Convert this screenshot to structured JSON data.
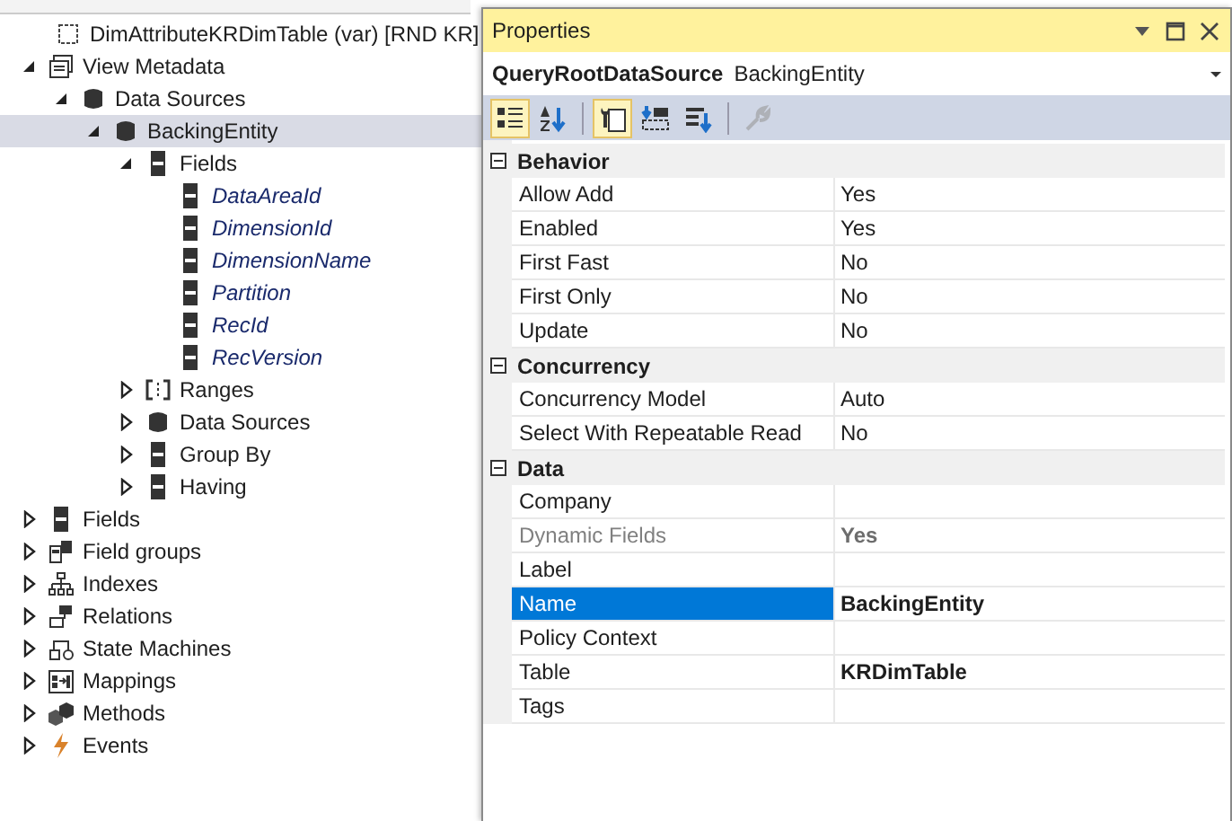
{
  "tree": {
    "label": "DimAttributeKRDimTable (var) [RND KR]",
    "kind": "root",
    "selected": false,
    "italic": false,
    "children": [
      {
        "label": "View Metadata",
        "kind": "view",
        "selected": false,
        "italic": false,
        "expanded": true,
        "children": [
          {
            "label": "Data Sources",
            "kind": "datasource",
            "selected": false,
            "italic": false,
            "expanded": true,
            "children": [
              {
                "label": "BackingEntity",
                "kind": "datasource",
                "selected": true,
                "italic": false,
                "expanded": true,
                "children": [
                  {
                    "label": "Fields",
                    "kind": "field",
                    "selected": false,
                    "italic": false,
                    "expanded": true,
                    "children": [
                      {
                        "label": "DataAreaId",
                        "kind": "field",
                        "selected": false,
                        "italic": true
                      },
                      {
                        "label": "DimensionId",
                        "kind": "field",
                        "selected": false,
                        "italic": true
                      },
                      {
                        "label": "DimensionName",
                        "kind": "field",
                        "selected": false,
                        "italic": true
                      },
                      {
                        "label": "Partition",
                        "kind": "field",
                        "selected": false,
                        "italic": true
                      },
                      {
                        "label": "RecId",
                        "kind": "field",
                        "selected": false,
                        "italic": true
                      },
                      {
                        "label": "RecVersion",
                        "kind": "field",
                        "selected": false,
                        "italic": true
                      }
                    ]
                  },
                  {
                    "label": "Ranges",
                    "kind": "ranges",
                    "selected": false,
                    "italic": false,
                    "expanded": false
                  },
                  {
                    "label": "Data Sources",
                    "kind": "datasource",
                    "selected": false,
                    "italic": false,
                    "expanded": false
                  },
                  {
                    "label": "Group By",
                    "kind": "field",
                    "selected": false,
                    "italic": false,
                    "expanded": false
                  },
                  {
                    "label": "Having",
                    "kind": "field",
                    "selected": false,
                    "italic": false,
                    "expanded": false
                  }
                ]
              }
            ]
          }
        ]
      },
      {
        "label": "Fields",
        "kind": "field",
        "selected": false,
        "italic": false,
        "expanded": false
      },
      {
        "label": "Field groups",
        "kind": "fieldgroups",
        "selected": false,
        "italic": false,
        "expanded": false
      },
      {
        "label": "Indexes",
        "kind": "indexes",
        "selected": false,
        "italic": false,
        "expanded": false
      },
      {
        "label": "Relations",
        "kind": "relations",
        "selected": false,
        "italic": false,
        "expanded": false
      },
      {
        "label": "State Machines",
        "kind": "statemachines",
        "selected": false,
        "italic": false,
        "expanded": false
      },
      {
        "label": "Mappings",
        "kind": "mappings",
        "selected": false,
        "italic": false,
        "expanded": false
      },
      {
        "label": "Methods",
        "kind": "methods",
        "selected": false,
        "italic": false,
        "expanded": false
      },
      {
        "label": "Events",
        "kind": "events",
        "selected": false,
        "italic": false,
        "expanded": false
      }
    ]
  },
  "properties": {
    "title": "Properties",
    "object_type": "QueryRootDataSource",
    "object_name": "BackingEntity",
    "toolbar": [
      {
        "kind": "categorized",
        "selected": true,
        "disabled": false
      },
      {
        "kind": "alphabetical",
        "selected": false,
        "disabled": false
      },
      {
        "kind": "properties",
        "selected": true,
        "disabled": false
      },
      {
        "kind": "events",
        "selected": false,
        "disabled": false
      },
      {
        "kind": "sort",
        "selected": false,
        "disabled": false
      },
      {
        "kind": "wrench",
        "selected": false,
        "disabled": true
      }
    ],
    "categories": [
      {
        "name": "Behavior",
        "expanded": true,
        "rows": [
          {
            "name": "Allow Add",
            "value": "Yes",
            "selected": false,
            "disabled": false,
            "modified": false
          },
          {
            "name": "Enabled",
            "value": "Yes",
            "selected": false,
            "disabled": false,
            "modified": false
          },
          {
            "name": "First Fast",
            "value": "No",
            "selected": false,
            "disabled": false,
            "modified": false
          },
          {
            "name": "First Only",
            "value": "No",
            "selected": false,
            "disabled": false,
            "modified": false
          },
          {
            "name": "Update",
            "value": "No",
            "selected": false,
            "disabled": false,
            "modified": false
          }
        ]
      },
      {
        "name": "Concurrency",
        "expanded": true,
        "rows": [
          {
            "name": "Concurrency Model",
            "value": "Auto",
            "selected": false,
            "disabled": false,
            "modified": false
          },
          {
            "name": "Select With Repeatable Read",
            "value": "No",
            "selected": false,
            "disabled": false,
            "modified": false
          }
        ]
      },
      {
        "name": "Data",
        "expanded": true,
        "rows": [
          {
            "name": "Company",
            "selected": false,
            "disabled": false,
            "modified": false
          },
          {
            "name": "Dynamic Fields",
            "value": "Yes",
            "selected": false,
            "disabled": true,
            "modified": true
          },
          {
            "name": "Label",
            "selected": false,
            "disabled": false,
            "modified": false
          },
          {
            "name": "Name",
            "value": "BackingEntity",
            "selected": true,
            "disabled": false,
            "modified": true
          },
          {
            "name": "Policy Context",
            "selected": false,
            "disabled": false,
            "modified": false
          },
          {
            "name": "Table",
            "value": "KRDimTable",
            "selected": false,
            "disabled": false,
            "modified": true
          },
          {
            "name": "Tags",
            "selected": false,
            "disabled": false,
            "modified": false
          }
        ]
      }
    ]
  }
}
